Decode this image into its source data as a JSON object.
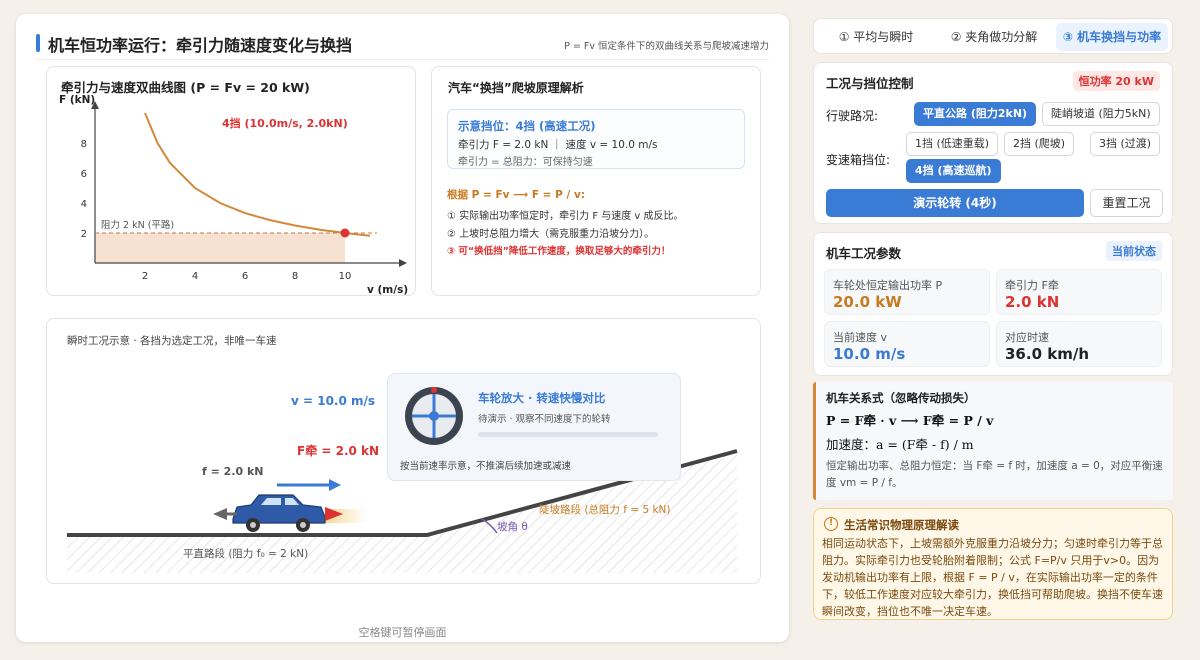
{
  "header": {
    "title": "机车恒功率运行：牵引力随速度变化与换挡",
    "subtitle": "P = Fv 恒定条件下的双曲线关系与爬坡减速增力"
  },
  "graph": {
    "title": "牵引力与速度双曲线图 (P = Fv = 20 kW)",
    "ylabel": "F (kN)",
    "xlabel": "v (m/s)",
    "point_label": "4挡 (10.0m/s, 2.0kN)",
    "resistance_label": "阻力 2 kN (平路)"
  },
  "chart_data": {
    "type": "line",
    "title": "牵引力与速度双曲线图 (P = Fv = 20 kW)",
    "xlabel": "v (m/s)",
    "ylabel": "F (kN)",
    "xlim": [
      0,
      12
    ],
    "ylim": [
      0,
      10
    ],
    "x_ticks": [
      2,
      4,
      6,
      8,
      10
    ],
    "y_ticks": [
      2,
      4,
      6,
      8
    ],
    "series": [
      {
        "x": [
          2,
          2.5,
          3,
          4,
          5,
          6,
          7,
          8,
          9,
          10,
          11
        ],
        "y": [
          10,
          8,
          6.67,
          5,
          4,
          3.33,
          2.86,
          2.5,
          2.22,
          2,
          1.82
        ]
      }
    ],
    "resistance_line": 2,
    "operating_point": {
      "x": 10,
      "y": 2,
      "label": "4挡 (10.0m/s, 2.0kN)"
    }
  },
  "explain": {
    "title": "汽车“换挡”爬坡原理解析",
    "gear_line1": "示意挡位：4挡 (高速工况)",
    "gear_line2": "牵引力 F = 2.0 kN ｜ 速度 v = 10.0 m/s",
    "gear_line3": "牵引力 = 总阻力：可保持匀速",
    "rule_head": "根据 P = Fv ⟶ F = P / v:",
    "rule1": "① 实际输出功率恒定时，牵引力 F 与速度 v 成反比。",
    "rule2": "② 上坡时总阻力增大（需克服重力沿坡分力）。",
    "rule3": "③ 可“换低挡”降低工作速度，换取足够大的牵引力！"
  },
  "scene": {
    "caption": "瞬时工况示意 · 各挡为选定工况，非唯一车速",
    "v_label": "v = 10.0 m/s",
    "f_traction": "F牵 = 2.0 kN",
    "f_resist": "f = 2.0 kN",
    "flat_label": "平直路段 (阻力 f₀ = 2 kN)",
    "slope_label": "陡坡路段 (总阻力 f = 5 kN)",
    "angle_label": "坡角 θ",
    "wheel_title": "车轮放大 · 转速快慢对比",
    "wheel_sub": "待演示 · 观察不同速度下的轮转",
    "wheel_note": "按当前速率示意，不推演后续加速或减速"
  },
  "pause_hint": "空格键可暂停画面",
  "tabs": [
    "① 平均与瞬时",
    "② 夹角做功分解",
    "③ 机车换挡与功率"
  ],
  "control": {
    "title": "工况与挡位控制",
    "power_badge": "恒功率 20 kW",
    "road_label": "行驶路况:",
    "road_options": [
      "平直公路 (阻力2kN)",
      "陡峭坡道 (阻力5kN)"
    ],
    "gear_label": "变速箱挡位:",
    "gear_options": [
      "1挡 (低速重载)",
      "2挡 (爬坡)",
      "3挡 (过渡)",
      "4挡 (高速巡航)"
    ],
    "demo_button": "演示轮转 (4秒)",
    "reset_button": "重置工况"
  },
  "params": {
    "title": "机车工况参数",
    "badge": "当前状态",
    "items": [
      {
        "label": "车轮处恒定输出功率 P",
        "value": "20.0 kW",
        "color": "#c87a20"
      },
      {
        "label": "牵引力 F牵",
        "value": "2.0 kN",
        "color": "#d33"
      },
      {
        "label": "当前速度 v",
        "value": "10.0 m/s",
        "color": "#3a7bd5"
      },
      {
        "label": "对应时速",
        "value": "36.0 km/h",
        "color": "#222"
      }
    ]
  },
  "relation": {
    "title": "机车关系式（忽略传动损失）",
    "f1": "P = F牵 · v ⟶ F牵 = P / v",
    "f2": "加速度：a = (F牵 - f) / m",
    "note": "恒定输出功率、总阻力恒定：当 F牵 = f 时，加速度 a = 0，对应平衡速度 vm = P / f。"
  },
  "life": {
    "title": "生活常识物理原理解读",
    "text": "相同运动状态下，上坡需额外克服重力沿坡分力；匀速时牵引力等于总阻力。实际牵引力也受轮胎附着限制；公式 F=P/v 只用于v>0。因为发动机输出功率有上限，根据 F = P / v，在实际输出功率一定的条件下，较低工作速度对应较大牵引力，换低挡可帮助爬坡。换挡不使车速瞬间改变，挡位也不唯一决定车速。"
  }
}
